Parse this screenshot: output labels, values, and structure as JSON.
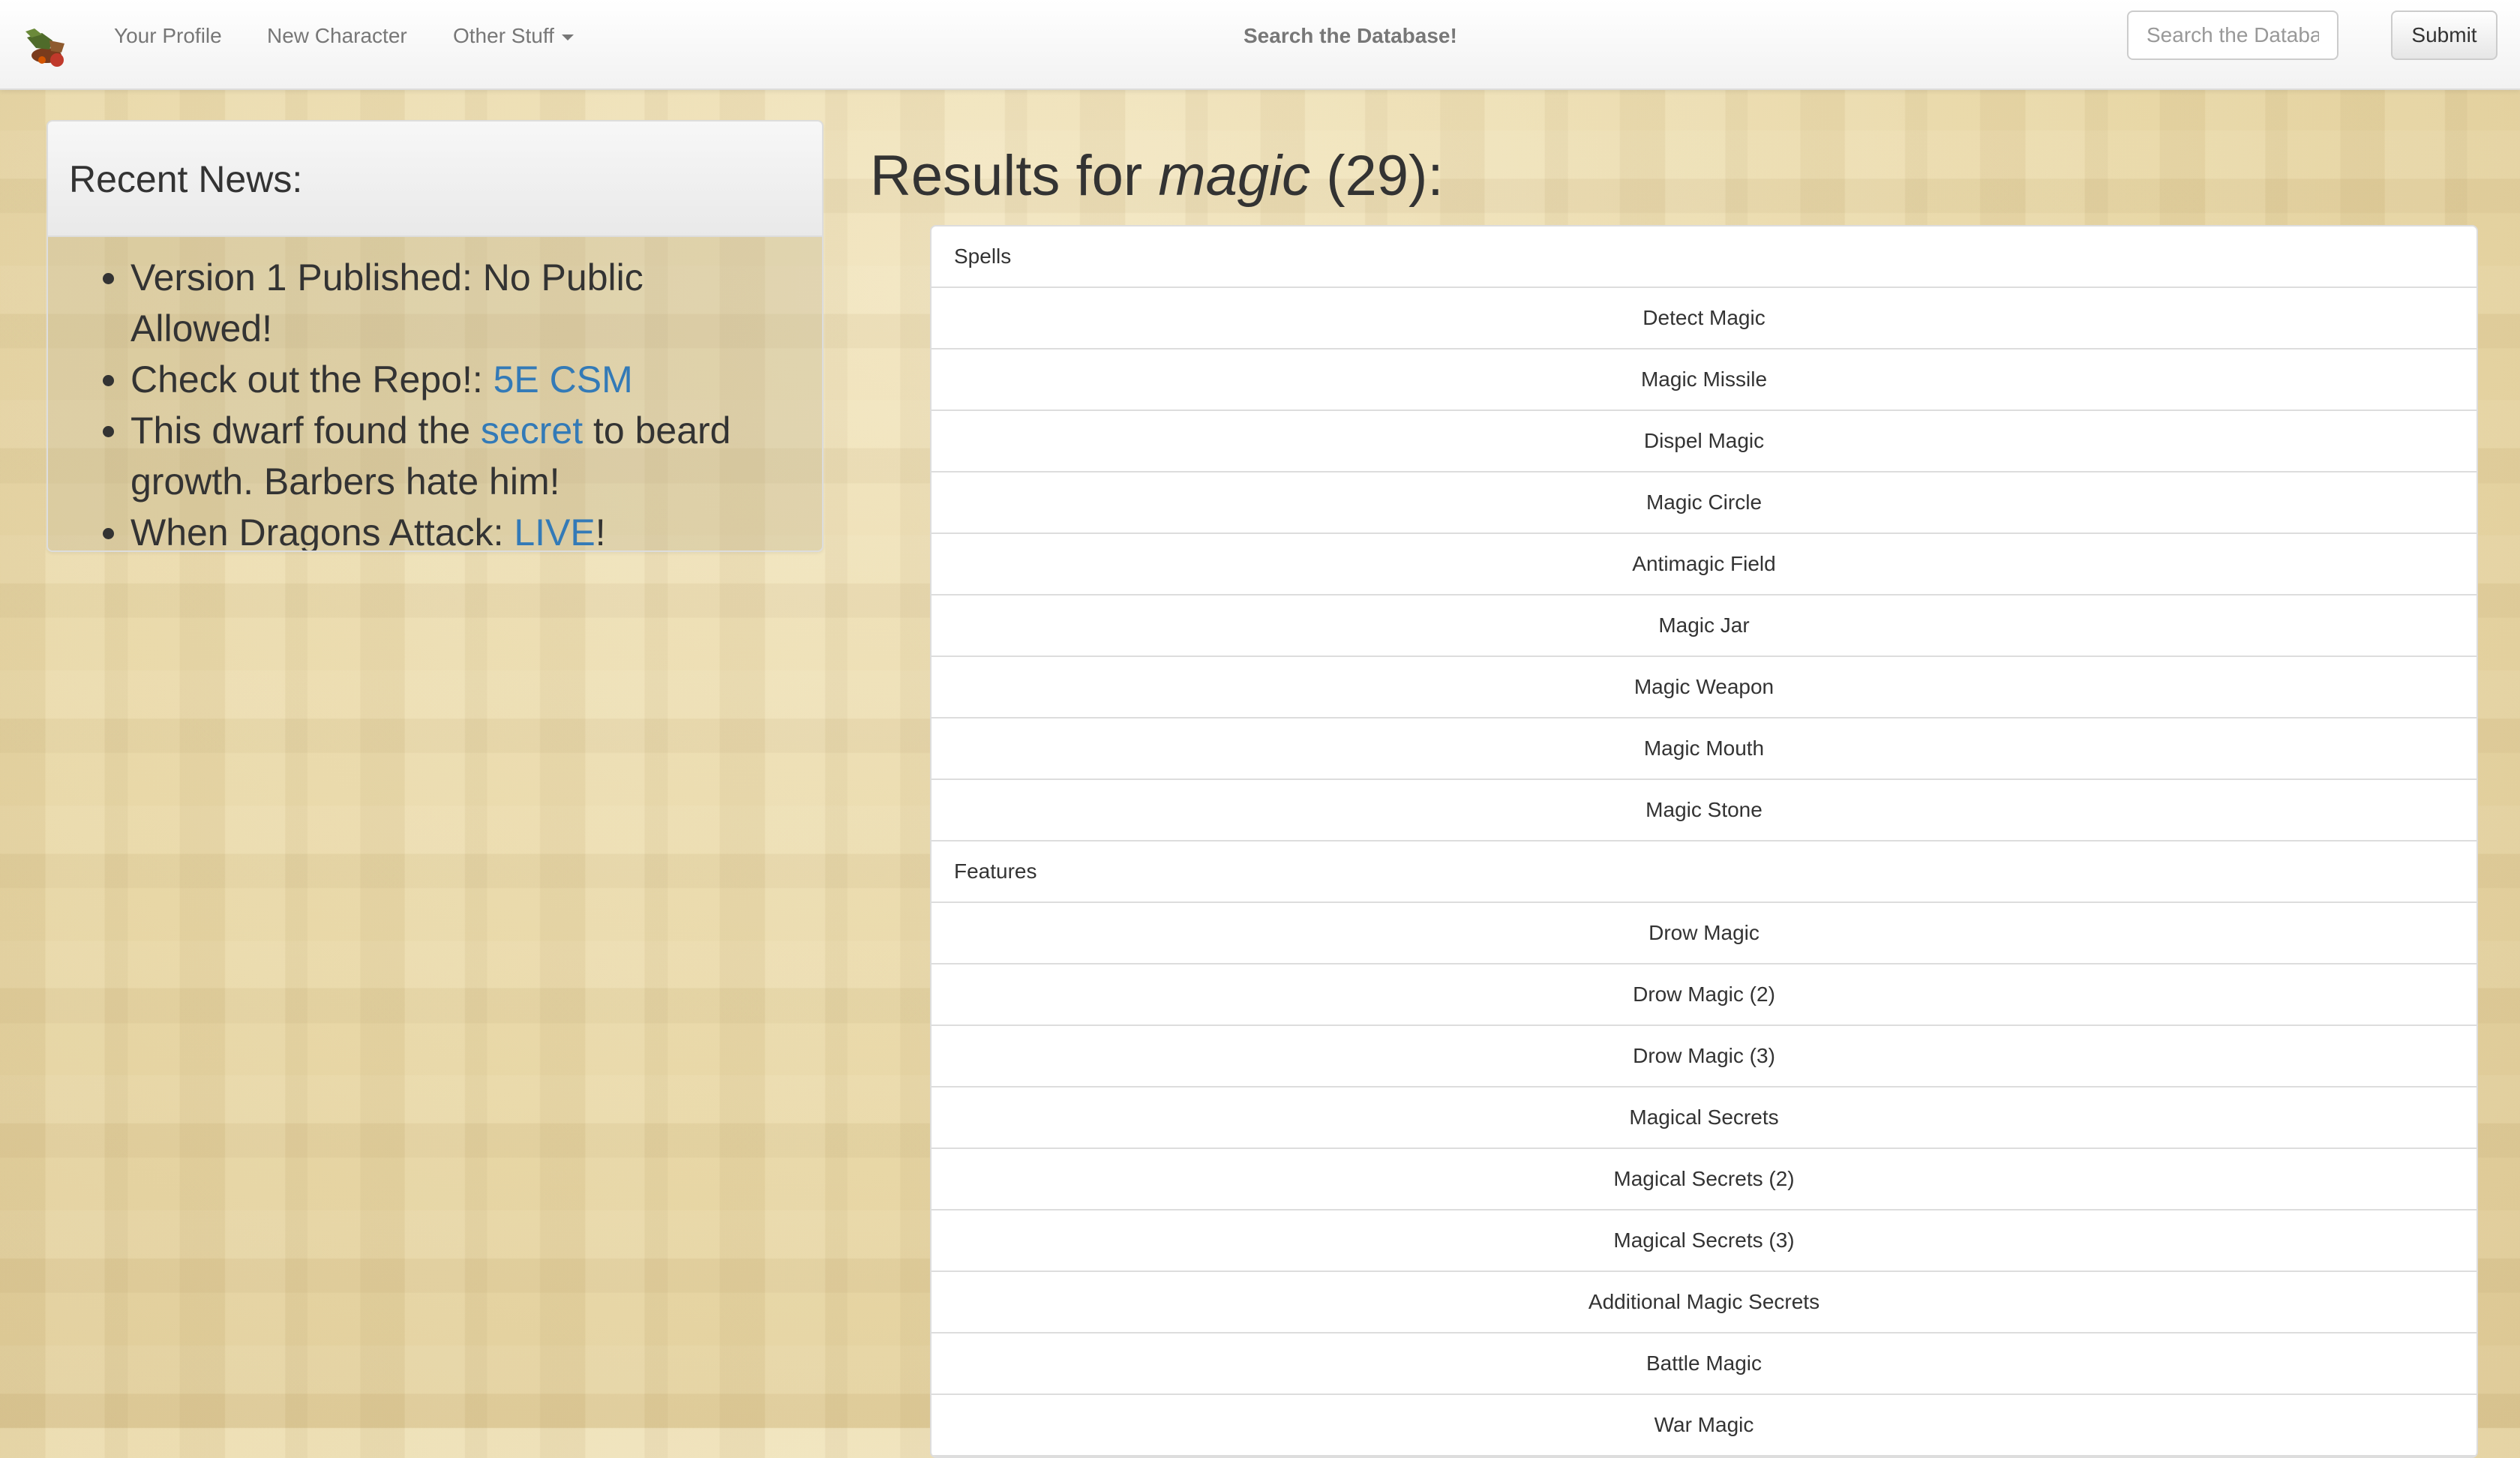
{
  "navbar": {
    "logo_icon": "dragon-logo-icon",
    "links": [
      {
        "label": "Your Profile"
      },
      {
        "label": "New Character"
      },
      {
        "label": "Other Stuff"
      }
    ],
    "center_label": "Search the Database!",
    "search_placeholder": "Search the Database!",
    "submit_label": "Submit"
  },
  "news": {
    "heading": "Recent News:",
    "item1": "Version 1 Published: No Public Allowed!",
    "item2": {
      "before": "Check out the Repo!: ",
      "link": "5E CSM"
    },
    "item3": {
      "before": "This dwarf found the ",
      "link": "secret",
      "after": " to beard growth. Barbers hate him!"
    },
    "item4": {
      "before": "When Dragons Attack: ",
      "link": "LIVE",
      "after": "!"
    }
  },
  "results": {
    "prefix": "Results for ",
    "query": "magic",
    "suffix": " (29):",
    "groups": [
      {
        "category": "Spells",
        "items": [
          "Detect Magic",
          "Magic Missile",
          "Dispel Magic",
          "Magic Circle",
          "Antimagic Field",
          "Magic Jar",
          "Magic Weapon",
          "Magic Mouth",
          "Magic Stone"
        ]
      },
      {
        "category": "Features",
        "items": [
          "Drow Magic",
          "Drow Magic (2)",
          "Drow Magic (3)",
          "Magical Secrets",
          "Magical Secrets (2)",
          "Magical Secrets (3)",
          "Additional Magic Secrets",
          "Battle Magic",
          "War Magic"
        ]
      }
    ]
  },
  "colors": {
    "link": "#337ab7",
    "navbar_bg": "#f8f8f8"
  }
}
